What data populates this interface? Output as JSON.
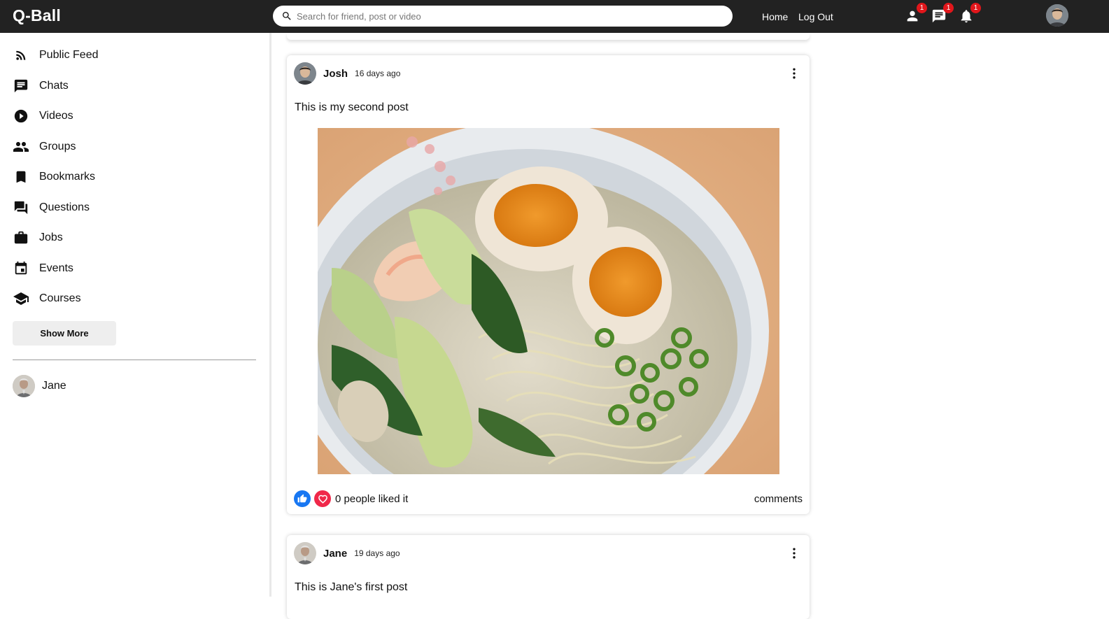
{
  "app": {
    "logo": "Q-Ball"
  },
  "search": {
    "placeholder": "Search for friend, post or video"
  },
  "topnav": {
    "links": [
      "Home",
      "Log Out"
    ],
    "badges": {
      "friends": "1",
      "messages": "1",
      "notifications": "1"
    }
  },
  "sidebar": {
    "items": [
      {
        "label": "Public Feed",
        "icon": "rss-feed-icon"
      },
      {
        "label": "Chats",
        "icon": "chat-icon"
      },
      {
        "label": "Videos",
        "icon": "play-circle-icon"
      },
      {
        "label": "Groups",
        "icon": "group-icon"
      },
      {
        "label": "Bookmarks",
        "icon": "bookmark-icon"
      },
      {
        "label": "Questions",
        "icon": "question-answer-icon"
      },
      {
        "label": "Jobs",
        "icon": "work-icon"
      },
      {
        "label": "Events",
        "icon": "event-icon"
      },
      {
        "label": "Courses",
        "icon": "school-icon"
      }
    ],
    "show_more": "Show More",
    "friends": [
      {
        "name": "Jane"
      }
    ]
  },
  "posts": [
    {
      "author": "Josh",
      "time": "16 days ago",
      "text": "This is my second post",
      "image": "ramen-bowl-photo",
      "likes": "0 people liked it",
      "comments": "comments"
    },
    {
      "author": "Jane",
      "time": "19 days ago",
      "text": "This is Jane's first post"
    }
  ],
  "colors": {
    "topbar": "#222222",
    "badge": "#e1161b",
    "like": "#1877f2",
    "love": "#f0284a"
  }
}
